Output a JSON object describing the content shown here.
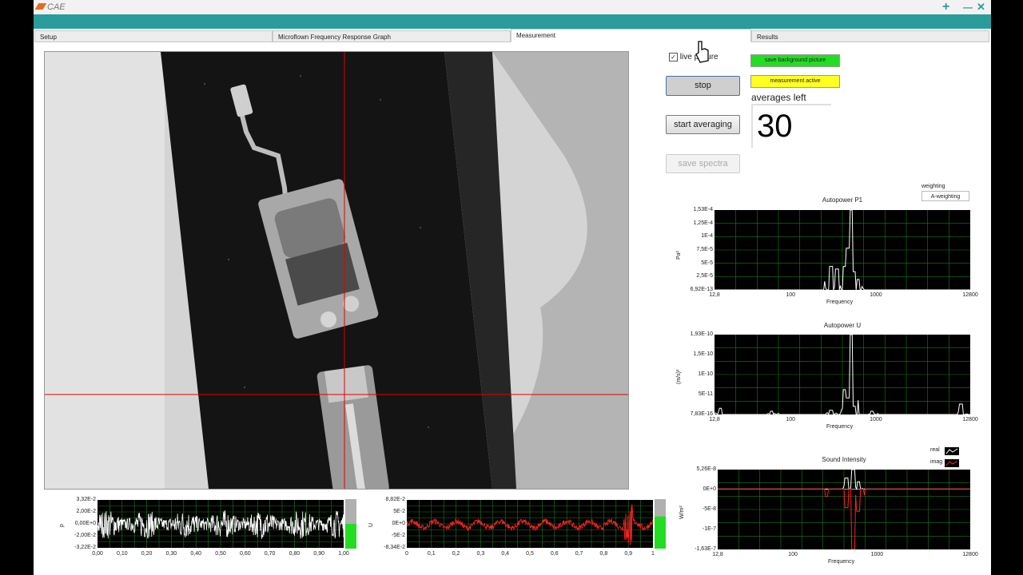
{
  "window": {
    "logo_text": "CAE",
    "plus_glyph": "+",
    "minimize_glyph": "—",
    "close_glyph": "✕"
  },
  "tabs": [
    {
      "label": "Setup",
      "active": false
    },
    {
      "label": "Microflown Frequency Response Graph",
      "active": false
    },
    {
      "label": "Measurement",
      "active": true
    },
    {
      "label": "Results",
      "active": false
    }
  ],
  "controls": {
    "live_picture_label": "live picture",
    "live_picture_checked": true,
    "save_background_label": "save background picture",
    "measurement_active_label": "measurement active",
    "stop_label": "stop",
    "start_averaging_label": "start averaging",
    "save_spectra_label": "save spectra",
    "averages_left_label": "averages left",
    "averages_left_value": "30",
    "weighting_label": "weighting",
    "weighting_value": "A-weighting"
  },
  "colors": {
    "accent": "#2b9c9c",
    "green_indicator": "#22dd22",
    "yellow_indicator": "#ffff22",
    "plot_bg": "#000000",
    "grid": "#1f7a1f",
    "trace_p": "#ffffff",
    "trace_u": "#ff2222"
  },
  "chart_data": [
    {
      "type": "line",
      "title": "Autopower P1",
      "xlabel": "Frequency",
      "ylabel": "Pa²",
      "x_scale": "log",
      "xlim": [
        12.8,
        12800
      ],
      "xticks": [
        "12,8",
        "100",
        "1000",
        "12800"
      ],
      "yticks": [
        "1,53E-4",
        "1,25E-4",
        "1E-4",
        "7,5E-5",
        "5E-5",
        "2,5E-5",
        "6,92E-13"
      ],
      "peaks": [
        {
          "x": 300,
          "y": 4.5e-05
        },
        {
          "x": 350,
          "y": 4e-05
        },
        {
          "x": 430,
          "y": 4.5e-05
        },
        {
          "x": 470,
          "y": 8e-05
        },
        {
          "x": 520,
          "y": 0.000153
        },
        {
          "x": 560,
          "y": 3.5e-05
        },
        {
          "x": 620,
          "y": 2e-05
        }
      ]
    },
    {
      "type": "line",
      "title": "Autopower U",
      "xlabel": "Frequency",
      "ylabel": "(m/s)²",
      "x_scale": "log",
      "xlim": [
        12.8,
        12800
      ],
      "xticks": [
        "12,8",
        "100",
        "1000",
        "12800"
      ],
      "yticks": [
        "1,93E-10",
        "1,5E-10",
        "1E-10",
        "5E-11",
        "7,83E-16"
      ],
      "peaks": [
        {
          "x": 15,
          "y": 1.5e-11
        },
        {
          "x": 60,
          "y": 8e-12
        },
        {
          "x": 300,
          "y": 1e-11
        },
        {
          "x": 430,
          "y": 6e-11
        },
        {
          "x": 470,
          "y": 4e-11
        },
        {
          "x": 520,
          "y": 1.93e-10
        },
        {
          "x": 560,
          "y": 2e-11
        },
        {
          "x": 900,
          "y": 8e-12
        },
        {
          "x": 10000,
          "y": 2.5e-11
        }
      ]
    },
    {
      "type": "line",
      "title": "Sound Intensity",
      "xlabel": "Frequency",
      "ylabel": "W/m²",
      "x_scale": "log",
      "xlim": [
        12.8,
        12800
      ],
      "xticks": [
        "12,8",
        "100",
        "1000",
        "12800"
      ],
      "yticks": [
        "5,26E-8",
        "0E+0",
        "-5E-8",
        "-1E-7",
        "-1,63E-7"
      ],
      "legend": [
        {
          "name": "real",
          "color": "#ffffff"
        },
        {
          "name": "imag",
          "color": "#ff2222"
        }
      ],
      "series": [
        {
          "name": "real",
          "peaks": [
            {
              "x": 430,
              "y": 3e-08
            },
            {
              "x": 520,
              "y": 5.26e-08
            },
            {
              "x": 600,
              "y": 2e-08
            }
          ]
        },
        {
          "name": "imag",
          "peaks": [
            {
              "x": 250,
              "y": -2e-08
            },
            {
              "x": 430,
              "y": -5e-08
            },
            {
              "x": 520,
              "y": -1.63e-07
            },
            {
              "x": 600,
              "y": -6e-08
            }
          ]
        }
      ]
    },
    {
      "type": "line",
      "title": "",
      "ylabel": "p",
      "xlim": [
        0,
        1
      ],
      "xticks": [
        "0,00",
        "0,10",
        "0,20",
        "0,30",
        "0,40",
        "0,50",
        "0,60",
        "0,70",
        "0,80",
        "0,90",
        "1,00"
      ],
      "yticks": [
        "3,32E-2",
        "2,00E-2",
        "0,00E+0",
        "-2,00E-2",
        "-3,22E-2"
      ],
      "ylim": [
        -0.0322,
        0.0332
      ],
      "level_fraction": 0.5
    },
    {
      "type": "line",
      "title": "",
      "ylabel": "U",
      "xlim": [
        0,
        1
      ],
      "xticks": [
        "0",
        "0,1",
        "0,2",
        "0,3",
        "0,4",
        "0,5",
        "0,6",
        "0,7",
        "0,8",
        "0,9",
        "1"
      ],
      "yticks": [
        "8,82E-2",
        "5E-2",
        "0E+0",
        "-5E-2",
        "-8,34E-2"
      ],
      "ylim": [
        -0.0834,
        0.0882
      ],
      "level_fraction": 0.65
    }
  ]
}
